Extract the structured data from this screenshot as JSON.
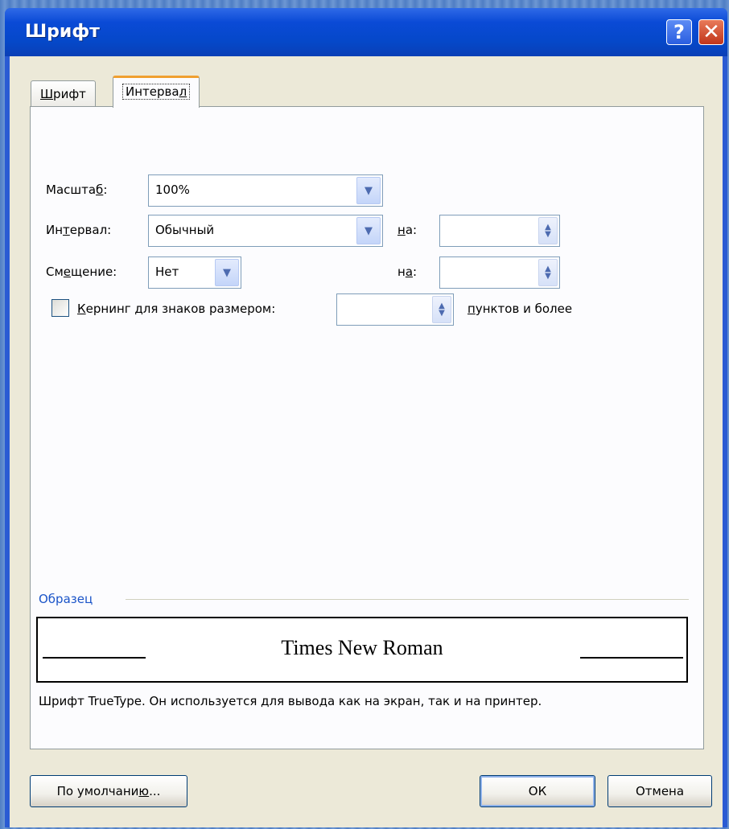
{
  "window": {
    "title": "Шрифт",
    "help_glyph": "?",
    "close_glyph": "✕"
  },
  "tabs": [
    {
      "pre": "",
      "key": "Ш",
      "post": "рифт"
    },
    {
      "pre": "Интерва",
      "key": "л",
      "post": ""
    }
  ],
  "fields": {
    "scale": {
      "label_pre": "Масшта",
      "label_key": "б",
      "label_post": ":",
      "value": "100%"
    },
    "spacing": {
      "label_pre": "Ин",
      "label_key": "т",
      "label_post": "ервал:",
      "value": "Обычный",
      "by_pre": "",
      "by_key": "н",
      "by_post": "а:",
      "by_value": ""
    },
    "position": {
      "label_pre": "См",
      "label_key": "е",
      "label_post": "щение:",
      "value": "Нет",
      "by_pre": "н",
      "by_key": "а",
      "by_post": ":",
      "by_value": ""
    },
    "kerning": {
      "checked": false,
      "label_pre": "",
      "label_key": "К",
      "label_post": "ернинг для знаков размером:",
      "value": "",
      "suffix_pre": "",
      "suffix_key": "п",
      "suffix_post": "унктов и более"
    }
  },
  "sample": {
    "label": "Образец",
    "text": "Times New Roman",
    "description": "Шрифт TrueType. Он используется для вывода как на экран, так и на принтер."
  },
  "buttons": {
    "default": {
      "pre": "По умолчани",
      "key": "ю",
      "post": "..."
    },
    "ok": "ОК",
    "cancel": "Отмена"
  },
  "colors": {
    "title_bar": "#0548c9",
    "client": "#ece9d8",
    "tab_highlight": "#f0a030",
    "sample_label": "#1a54c8"
  },
  "icons": {
    "dropdown": "chevron-down-icon",
    "spinner": "spinner-arrows-icon"
  }
}
